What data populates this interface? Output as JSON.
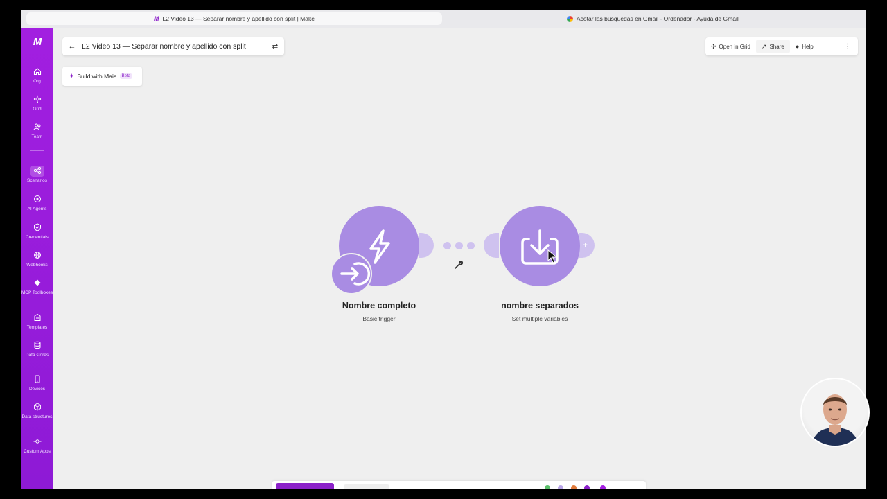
{
  "browser": {
    "active_tab": "L2 Video 13 — Separar nombre y apellido con split | Make",
    "inactive_tab": "Acotar las búsquedas en Gmail - Ordenador - Ayuda de Gmail"
  },
  "sidebar": {
    "brand": "M",
    "items": [
      {
        "label": "Org",
        "icon": "home-icon"
      },
      {
        "label": "Grid",
        "icon": "grid-icon"
      },
      {
        "label": "Team",
        "icon": "team-icon"
      },
      {
        "label": "Scenarios",
        "icon": "scenarios-icon",
        "active": true
      },
      {
        "label": "AI Agents",
        "icon": "ai-agents-icon"
      },
      {
        "label": "Credentials",
        "icon": "credentials-icon"
      },
      {
        "label": "Webhooks",
        "icon": "webhooks-icon"
      },
      {
        "label": "MCP Toolboxes",
        "icon": "mcp-icon"
      },
      {
        "label": "Templates",
        "icon": "templates-icon"
      },
      {
        "label": "Data stores",
        "icon": "data-stores-icon"
      },
      {
        "label": "Devices",
        "icon": "devices-icon"
      },
      {
        "label": "Data structures",
        "icon": "data-structures-icon"
      },
      {
        "label": "Custom Apps",
        "icon": "custom-apps-icon"
      }
    ]
  },
  "header": {
    "scenario_title": "L2 Video 13 — Separar nombre y apellido con split",
    "maia_label": "Build with Maia",
    "beta_label": "Beta",
    "open_in_grid": "Open in Grid",
    "share": "Share",
    "help": "Help"
  },
  "nodes": [
    {
      "title": "Nombre completo",
      "subtitle": "Basic trigger",
      "icon": "lightning-icon"
    },
    {
      "title": "nombre separados",
      "subtitle": "Set multiple variables",
      "icon": "download-tray-icon"
    }
  ],
  "colors": {
    "sidebar": "#9b1de0",
    "node": "#a98ce3",
    "handle": "#cfc2ef",
    "accent": "#8b21c9"
  }
}
